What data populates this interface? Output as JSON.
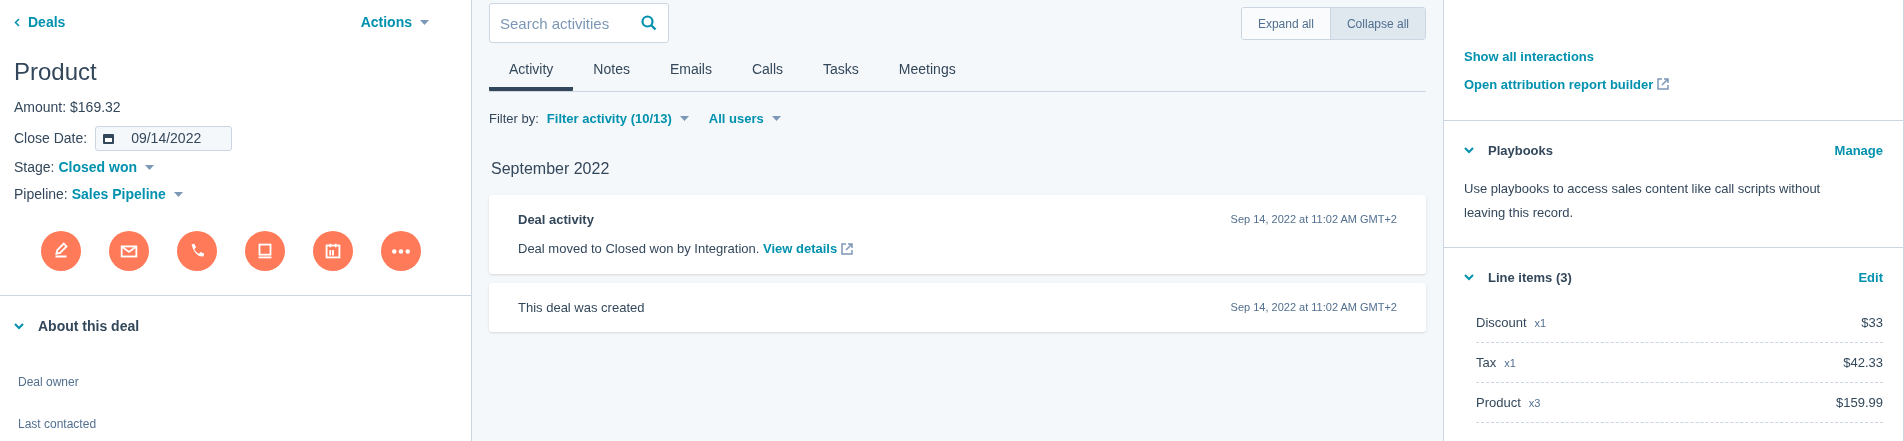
{
  "left_panel": {
    "back_link": "Deals",
    "actions": "Actions",
    "title": "Product",
    "amount": "Amount: $169.32",
    "close_date": {
      "label": "Close Date:",
      "value": "09/14/2022"
    },
    "stage": {
      "label": "Stage:",
      "value": "Closed won"
    },
    "pipeline": {
      "label": "Pipeline:",
      "value": "Sales Pipeline"
    },
    "about": {
      "title": "About this deal",
      "expanded": true,
      "fields": [
        "Deal owner",
        "Last contacted"
      ]
    }
  },
  "timeline": {
    "search": {
      "placeholder": "Search activities"
    },
    "toggle": [
      {
        "label": "Expand all",
        "selected": false
      },
      {
        "label": "Collapse all",
        "selected": true
      }
    ],
    "tabs": [
      {
        "label": "Activity",
        "selected": true
      },
      {
        "label": "Notes",
        "selected": false
      },
      {
        "label": "Emails",
        "selected": false
      },
      {
        "label": "Calls",
        "selected": false
      },
      {
        "label": "Tasks",
        "selected": false
      },
      {
        "label": "Meetings",
        "selected": false
      }
    ],
    "filter": {
      "label": "Filter by:",
      "activity": "Filter activity (10/13)",
      "users": "All users"
    },
    "month": "September 2022",
    "cards": [
      {
        "title": "Deal activity",
        "time": "Sep 14, 2022 at 11:02 AM GMT+2",
        "body": "Deal moved to Closed won by Integration.",
        "link": "View details"
      },
      {
        "body": "This deal was created",
        "time": "Sep 14, 2022 at 11:02 AM GMT+2"
      }
    ]
  },
  "right_panel": {
    "links": [
      {
        "label": "Show all interactions",
        "external": false
      },
      {
        "label": "Open attribution report builder",
        "external": true
      }
    ],
    "playbooks": {
      "title": "Playbooks",
      "action": "Manage",
      "expanded": true,
      "description": "Use playbooks to access sales content like call scripts without leaving this record."
    },
    "line_items": {
      "title": "Line items (3)",
      "action": "Edit",
      "expanded": true,
      "items": [
        {
          "name": "Discount",
          "qty": "x1",
          "price": "$33"
        },
        {
          "name": "Tax",
          "qty": "x1",
          "price": "$42.33"
        },
        {
          "name": "Product",
          "qty": "x3",
          "price": "$159.99"
        }
      ]
    }
  }
}
